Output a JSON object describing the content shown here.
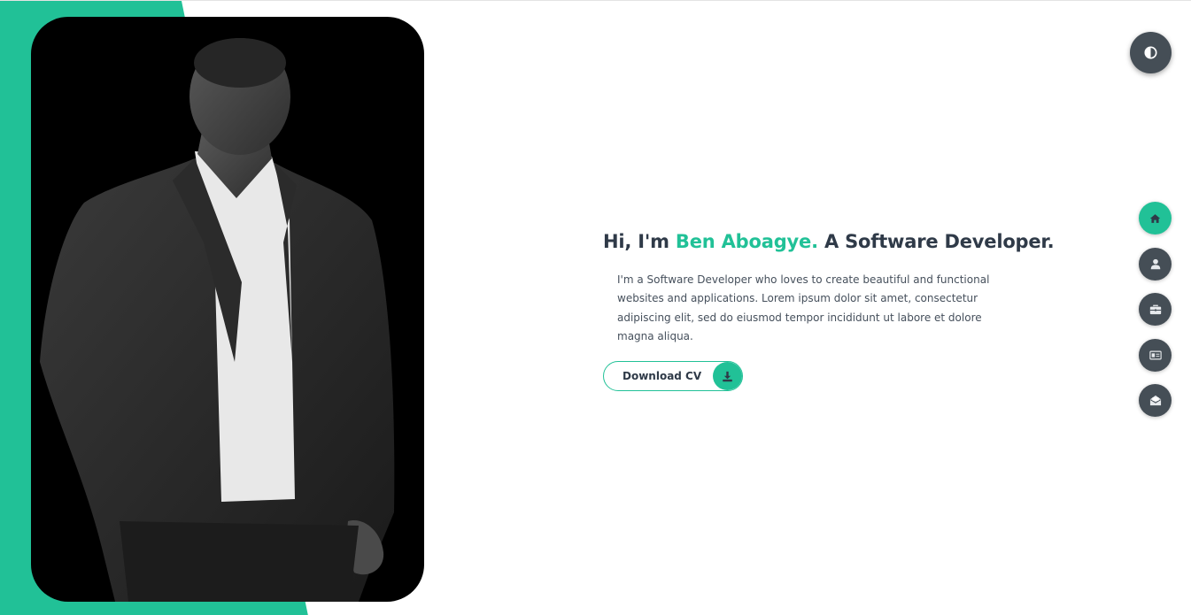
{
  "colors": {
    "accent": "#21c197",
    "dark": "#454e56",
    "heading": "#2f3a48",
    "text": "#46505c"
  },
  "hero": {
    "greeting": "Hi, I'm ",
    "name": "Ben Aboagye.",
    "role": " A Software Developer.",
    "description": "I'm a Software Developer who loves to create beautiful and functional websites and applications. Lorem ipsum dolor sit amet, consectetur adipiscing elit, sed do eiusmod tempor incididunt ut labore et dolore magna aliqua.",
    "cv_button_label": "Download CV",
    "cv_icon": "download-icon"
  },
  "theme_toggle": {
    "icon": "contrast-icon"
  },
  "side_nav": {
    "items": [
      {
        "icon": "home-icon",
        "active": true
      },
      {
        "icon": "user-icon",
        "active": false
      },
      {
        "icon": "briefcase-icon",
        "active": false
      },
      {
        "icon": "id-card-icon",
        "active": false
      },
      {
        "icon": "envelope-open-icon",
        "active": false
      }
    ]
  },
  "portrait": {
    "description_icon": "portrait-photo"
  }
}
